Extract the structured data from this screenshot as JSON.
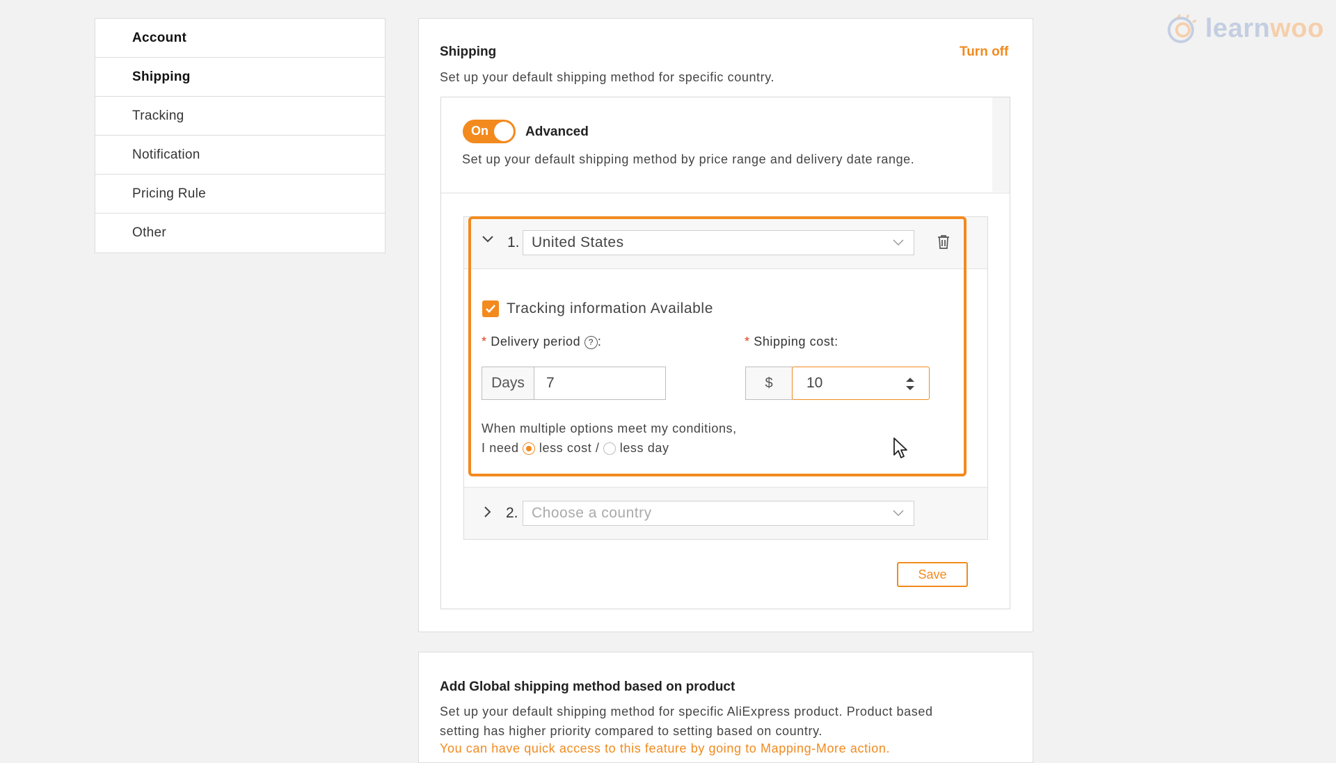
{
  "sidebar": {
    "items": [
      {
        "label": "Account"
      },
      {
        "label": "Shipping"
      },
      {
        "label": "Tracking"
      },
      {
        "label": "Notification"
      },
      {
        "label": "Pricing Rule"
      },
      {
        "label": "Other"
      }
    ]
  },
  "shipping": {
    "title": "Shipping",
    "turn_off": "Turn off",
    "description": "Set up your default shipping method for specific country.",
    "advanced": {
      "toggle_label": "On",
      "label": "Advanced",
      "description": "Set up your default shipping method by price range and delivery date range."
    },
    "rules": [
      {
        "index": "1.",
        "country": "United States",
        "tracking_label": "Tracking information Available",
        "tracking_checked": true,
        "delivery_label": "Delivery period",
        "help": "?",
        "colon": ":",
        "days_addon": "Days",
        "days_value": "7",
        "cost_label": "Shipping cost",
        "cost_colon": ":",
        "currency": "$",
        "cost_value": "10",
        "condition_line1": "When multiple options meet my conditions,",
        "condition_prefix": "I need",
        "option_less_cost": "less cost /",
        "option_less_day": "less day",
        "selected_option": "less cost"
      },
      {
        "index": "2.",
        "placeholder": "Choose a country"
      }
    ],
    "save": "Save"
  },
  "global": {
    "title": "Add Global shipping method based on product",
    "desc1": "Set up your default shipping method for specific AliExpress product. Product based",
    "desc2": "setting has higher priority compared to setting based on country.",
    "link": "You can have quick access to this feature by going to Mapping-More action."
  },
  "logo": {
    "part1": "learn",
    "part2": "woo"
  },
  "colors": {
    "accent": "#f28a1e",
    "required": "#e03c1e"
  },
  "icons": {
    "collapse": "chevron-down-icon",
    "expand": "chevron-right-icon",
    "delete": "trash-icon",
    "help": "question-circle-icon",
    "check": "checkmark-icon"
  }
}
